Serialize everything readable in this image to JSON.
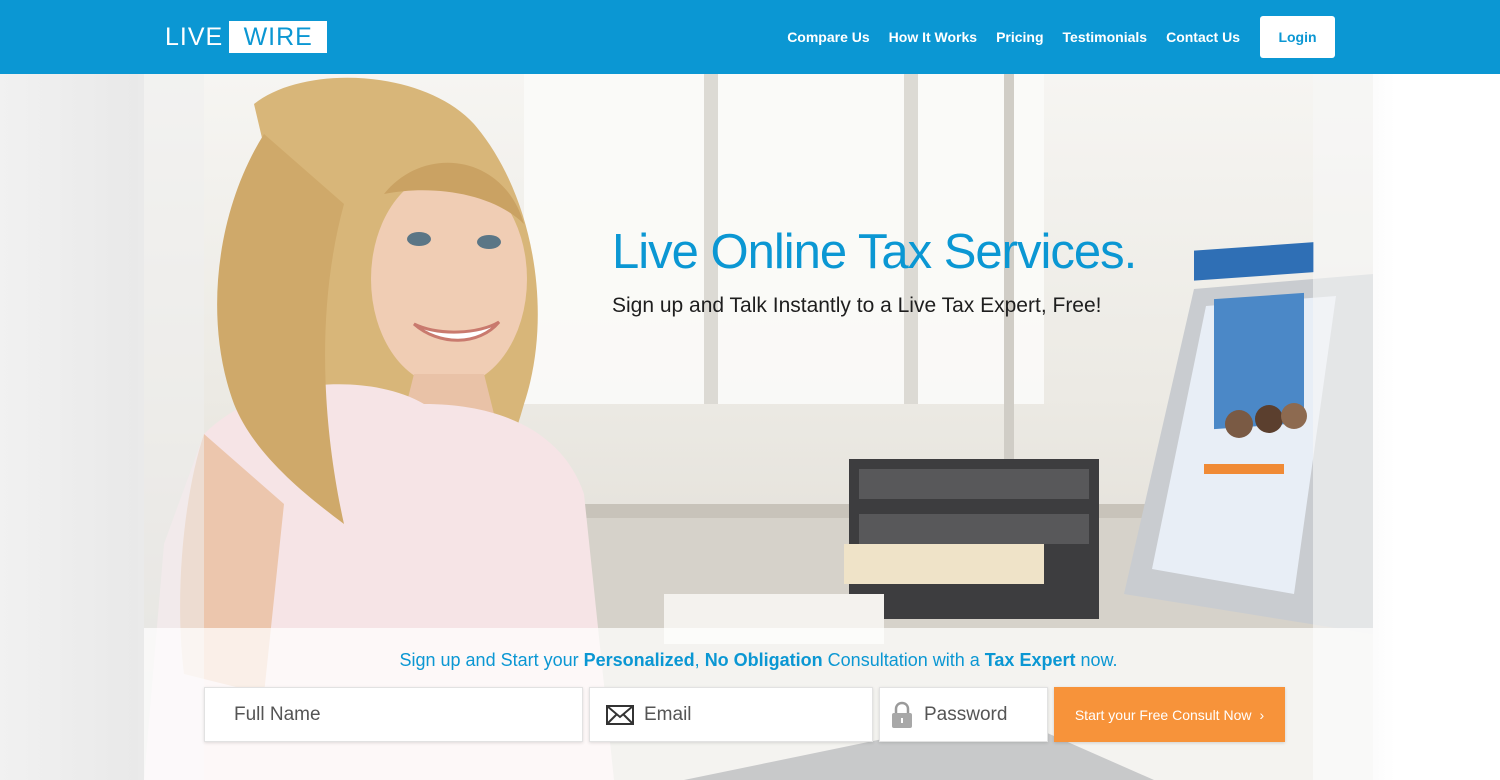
{
  "brand": {
    "logo_left": "LIVE",
    "logo_right": "WIRE"
  },
  "nav": {
    "links": [
      "Compare Us",
      "How It Works",
      "Pricing",
      "Testimonials",
      "Contact Us"
    ],
    "login": "Login"
  },
  "hero": {
    "headline": "Live Online Tax Services.",
    "subheadline": "Sign up and Talk Instantly to a Live Tax Expert, Free!"
  },
  "signup": {
    "tagline": {
      "p1": "Sign up and Start your ",
      "b1": "Personalized",
      "p2": ", ",
      "b2": "No Obligation",
      "p3": " Consultation with a ",
      "b3": "Tax Expert",
      "p4": " now."
    },
    "name_placeholder": "Full Name",
    "email_placeholder": "Email",
    "password_placeholder": "Password",
    "cta_label": "Start your Free Consult Now",
    "cta_arrow": "›"
  },
  "colors": {
    "brand_blue": "#0b97d3",
    "cta_orange": "#f7933a"
  },
  "icons": {
    "email": "envelope-icon",
    "password": "lock-icon",
    "cta": "chevron-right-icon"
  }
}
